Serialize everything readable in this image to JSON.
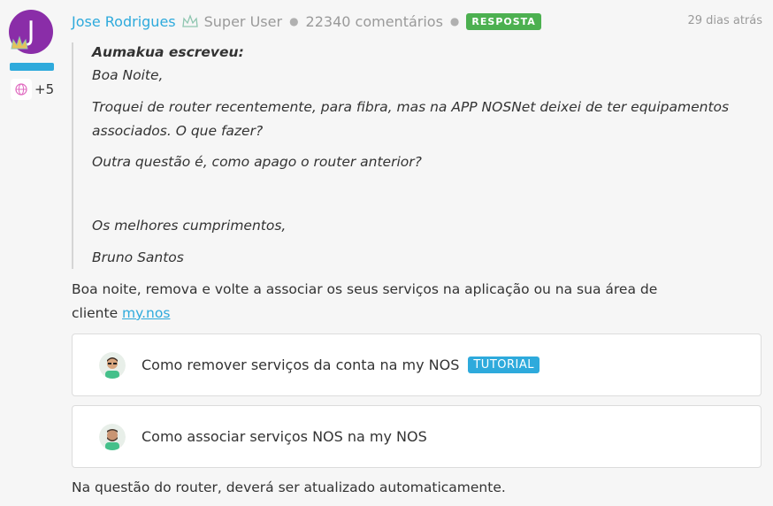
{
  "author": {
    "initial": "J",
    "name": "Jose Rodrigues",
    "role": "Super User",
    "comments": "22340 comentários",
    "answer_badge": "RESPOSTA",
    "time": "29 dias atrás",
    "badge_count": "+5"
  },
  "quote": {
    "author_line": "Aumakua escreveu:",
    "lines": [
      "Boa Noite,",
      "Troquei de router recentemente, para fibra, mas na APP NOSNet deixei de ter equipamentos",
      "associados. O que fazer?",
      "Outra questão é, como apago o router anterior?",
      "Os melhores cumprimentos,",
      "Bruno Santos"
    ]
  },
  "reply": {
    "line1": "Boa noite, remova e volte a associar os seus serviços na aplicação ou na sua área de",
    "line2_prefix": "cliente ",
    "link": "my.nos",
    "closing": "Na questão do router, deverá ser atualizado automaticamente."
  },
  "cards": [
    {
      "title": "Como remover serviços da conta na my NOS",
      "badge": "TUTORIAL",
      "avatar_icon": "agent-avatar-icon"
    },
    {
      "title": "Como associar serviços NOS na my NOS",
      "avatar_icon": "agent-avatar-icon"
    }
  ],
  "colors": {
    "accent": "#2eaadc",
    "avatar_bg": "#8a2da8",
    "answer_green": "#4cb050"
  }
}
